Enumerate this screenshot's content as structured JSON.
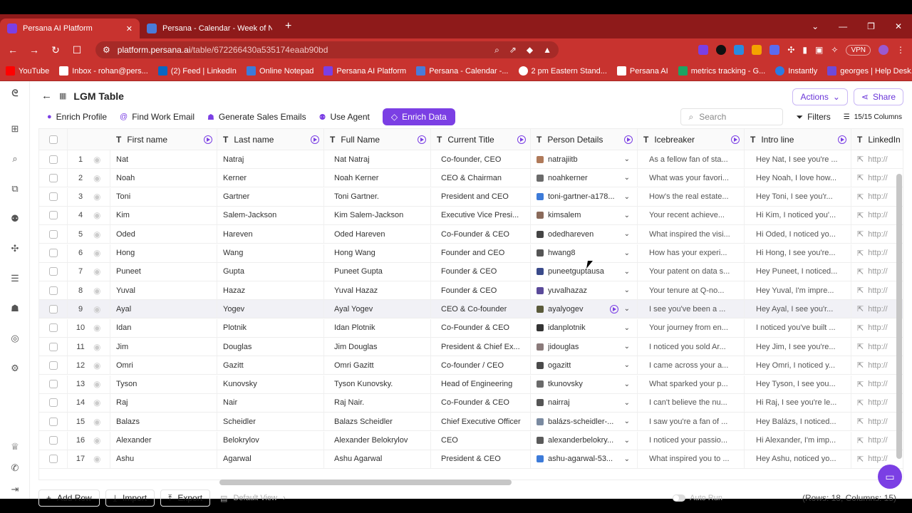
{
  "browser": {
    "tabs": [
      {
        "label": "Persana AI Platform",
        "active": true
      },
      {
        "label": "Persana - Calendar - Week of Nover",
        "active": false
      }
    ],
    "url_host": "platform.persana.ai",
    "url_path": "/table/672266430a535174eaab90bd",
    "vpn_label": "VPN",
    "bookmarks": [
      "YouTube",
      "Inbox - rohan@pers...",
      "(2) Feed | LinkedIn",
      "Online Notepad",
      "Persana AI Platform",
      "Persana - Calendar -...",
      "2 pm Eastern Stand...",
      "Persana AI",
      "metrics tracking - G...",
      "Instantly",
      "georges | Help Desk..."
    ]
  },
  "header": {
    "title": "LGM Table",
    "actions_label": "Actions",
    "share_label": "Share"
  },
  "toolbar": {
    "enrich_profile": "Enrich Profile",
    "find_work_email": "Find Work Email",
    "generate_sales_emails": "Generate Sales Emails",
    "use_agent": "Use Agent",
    "enrich_data": "Enrich Data",
    "search_placeholder": "Search",
    "filters": "Filters",
    "columns": "15/15 Columns"
  },
  "table": {
    "columns": [
      "First name",
      "Last name",
      "Full Name",
      "Current Title",
      "Person Details",
      "Icebreaker",
      "Intro line",
      "LinkedIn"
    ],
    "rows": [
      {
        "n": "1",
        "first": "Nat",
        "last": "Natraj",
        "full": "Nat Natraj",
        "title": "Co-founder, CEO",
        "details": "natrajiitb",
        "ice": "As a fellow fan of sta...",
        "intro": "Hey Nat, I see you're ...",
        "link": "http://"
      },
      {
        "n": "2",
        "first": "Noah",
        "last": "Kerner",
        "full": "Noah Kerner",
        "title": "CEO & Chairman",
        "details": "noahkerner",
        "ice": "What was your favori...",
        "intro": "Hey Noah, I love how...",
        "link": "http://"
      },
      {
        "n": "3",
        "first": "Toni",
        "last": "Gartner",
        "full": "Toni Gartner.",
        "title": "President and CEO",
        "details": "toni-gartner-a178...",
        "ice": "How's the real estate...",
        "intro": "Hey Toni, I see you'r...",
        "link": "http://"
      },
      {
        "n": "4",
        "first": "Kim",
        "last": "Salem-Jackson",
        "full": "Kim Salem-Jackson",
        "title": "Executive Vice Presi...",
        "details": "kimsalem",
        "ice": "Your recent achieve...",
        "intro": "Hi Kim, I noticed you'...",
        "link": "http://"
      },
      {
        "n": "5",
        "first": "Oded",
        "last": "Hareven",
        "full": "Oded Hareven",
        "title": "Co-Founder & CEO",
        "details": "odedhareven",
        "ice": "What inspired the visi...",
        "intro": "Hi Oded, I noticed yo...",
        "link": "http://"
      },
      {
        "n": "6",
        "first": "Hong",
        "last": "Wang",
        "full": "Hong Wang",
        "title": "Founder and CEO",
        "details": "hwang8",
        "ice": "How has your experi...",
        "intro": "Hi Hong, I see you're...",
        "link": "http://"
      },
      {
        "n": "7",
        "first": "Puneet",
        "last": "Gupta",
        "full": "Puneet Gupta",
        "title": "Founder & CEO",
        "details": "puneetguptausa",
        "ice": "Your patent on data s...",
        "intro": "Hey Puneet, I noticed...",
        "link": "http://"
      },
      {
        "n": "8",
        "first": "Yuval",
        "last": "Hazaz",
        "full": "Yuval Hazaz",
        "title": "Founder & CEO",
        "details": "yuvalhazaz",
        "ice": "Your tenure at Q-no...",
        "intro": "Hey Yuval, I'm impre...",
        "link": "http://"
      },
      {
        "n": "9",
        "first": "Ayal",
        "last": "Yogev",
        "full": "Ayal Yogev",
        "title": "CEO & Co-founder",
        "details": "ayalyogev",
        "ice": "I see you've been a ...",
        "intro": "Hey Ayal, I see you'r...",
        "link": "http://"
      },
      {
        "n": "10",
        "first": "Idan",
        "last": "Plotnik",
        "full": "Idan Plotnik",
        "title": "Co-Founder & CEO",
        "details": "idanplotnik",
        "ice": "Your journey from en...",
        "intro": "I noticed you've built ...",
        "link": "http://"
      },
      {
        "n": "11",
        "first": "Jim",
        "last": "Douglas",
        "full": "Jim Douglas",
        "title": "President & Chief Ex...",
        "details": "jidouglas",
        "ice": "I noticed you sold Ar...",
        "intro": "Hey Jim, I see you're...",
        "link": "http://"
      },
      {
        "n": "12",
        "first": "Omri",
        "last": "Gazitt",
        "full": "Omri Gazitt",
        "title": "Co-founder / CEO",
        "details": "ogazitt",
        "ice": "I came across your a...",
        "intro": "Hey Omri, I noticed y...",
        "link": "http://"
      },
      {
        "n": "13",
        "first": "Tyson",
        "last": "Kunovsky",
        "full": "Tyson Kunovsky.",
        "title": "Head of Engineering",
        "details": "tkunovsky",
        "ice": "What sparked your p...",
        "intro": "Hey Tyson, I see you...",
        "link": "http://"
      },
      {
        "n": "14",
        "first": "Raj",
        "last": "Nair",
        "full": "Raj Nair.",
        "title": "Co-Founder & CEO",
        "details": "nairraj",
        "ice": "I can't believe the nu...",
        "intro": "Hi Raj, I see you're le...",
        "link": "http://"
      },
      {
        "n": "15",
        "first": "Balazs",
        "last": "Scheidler",
        "full": "Balazs Scheidler",
        "title": "Chief Executive Officer",
        "details": "balázs-scheidler-...",
        "ice": "I saw you're a fan of ...",
        "intro": "Hey Balázs, I noticed...",
        "link": "http://"
      },
      {
        "n": "16",
        "first": "Alexander",
        "last": "Belokrylov",
        "full": "Alexander Belokrylov",
        "title": "CEO",
        "details": "alexanderbelokry...",
        "ice": "I noticed your passio...",
        "intro": "Hi Alexander, I'm imp...",
        "link": "http://"
      },
      {
        "n": "17",
        "first": "Ashu",
        "last": "Agarwal",
        "full": "Ashu Agarwal",
        "title": "President & CEO",
        "details": "ashu-agarwal-53...",
        "ice": "What inspired you to ...",
        "intro": "Hey Ashu, noticed yo...",
        "link": "http://"
      }
    ]
  },
  "footer": {
    "add_row": "Add Row",
    "import": "Import",
    "export": "Export",
    "default_view": "Default View",
    "auto_run": "Auto Run",
    "rows_info": "(Rows: 18, Columns: 15)"
  },
  "colors": {
    "accent": "#7b3fe4",
    "browser_frame": "#c8332f"
  }
}
